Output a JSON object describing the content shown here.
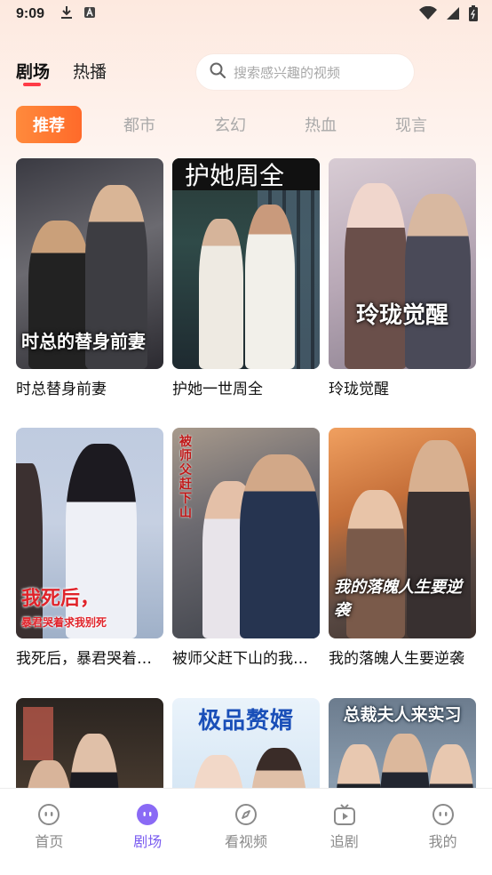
{
  "status_bar": {
    "time": "9:09"
  },
  "header": {
    "tabs": [
      {
        "label": "剧场",
        "active": true
      },
      {
        "label": "热播",
        "active": false
      }
    ],
    "search_placeholder": "搜索感兴趣的视频"
  },
  "categories": [
    {
      "label": "推荐",
      "active": true
    },
    {
      "label": "都市",
      "active": false
    },
    {
      "label": "玄幻",
      "active": false
    },
    {
      "label": "热血",
      "active": false
    },
    {
      "label": "现言",
      "active": false
    }
  ],
  "dramas": [
    {
      "title": "时总替身前妻",
      "poster_text": "时总的替身前妻"
    },
    {
      "title": "护她一世周全",
      "poster_text": "护她周全"
    },
    {
      "title": "玲珑觉醒",
      "poster_text": "玲珑觉醒"
    },
    {
      "title": "我死后，暴君哭着求我别死",
      "poster_text": "我死后，",
      "poster_text_2": "暴君哭着求我别死"
    },
    {
      "title": "被师父赶下山的我无敌了",
      "poster_text": "被师父赶下山"
    },
    {
      "title": "我的落魄人生要逆袭",
      "poster_text": "我的落魄人生要逆袭"
    },
    {
      "title": "",
      "poster_text": ""
    },
    {
      "title": "",
      "poster_text": "极品赘婿"
    },
    {
      "title": "",
      "poster_text": "总裁夫人来实习"
    }
  ],
  "bottom_nav": [
    {
      "label": "首页",
      "active": false,
      "icon": "home-face-icon"
    },
    {
      "label": "剧场",
      "active": true,
      "icon": "theater-face-icon"
    },
    {
      "label": "看视频",
      "active": false,
      "icon": "compass-icon"
    },
    {
      "label": "追剧",
      "active": false,
      "icon": "tv-play-icon"
    },
    {
      "label": "我的",
      "active": false,
      "icon": "profile-face-icon"
    }
  ],
  "colors": {
    "accent_red": "#ff3a46",
    "category_active_gradient": [
      "#ff8a3c",
      "#ff6a2a"
    ],
    "nav_active": "#7a5cf0"
  }
}
